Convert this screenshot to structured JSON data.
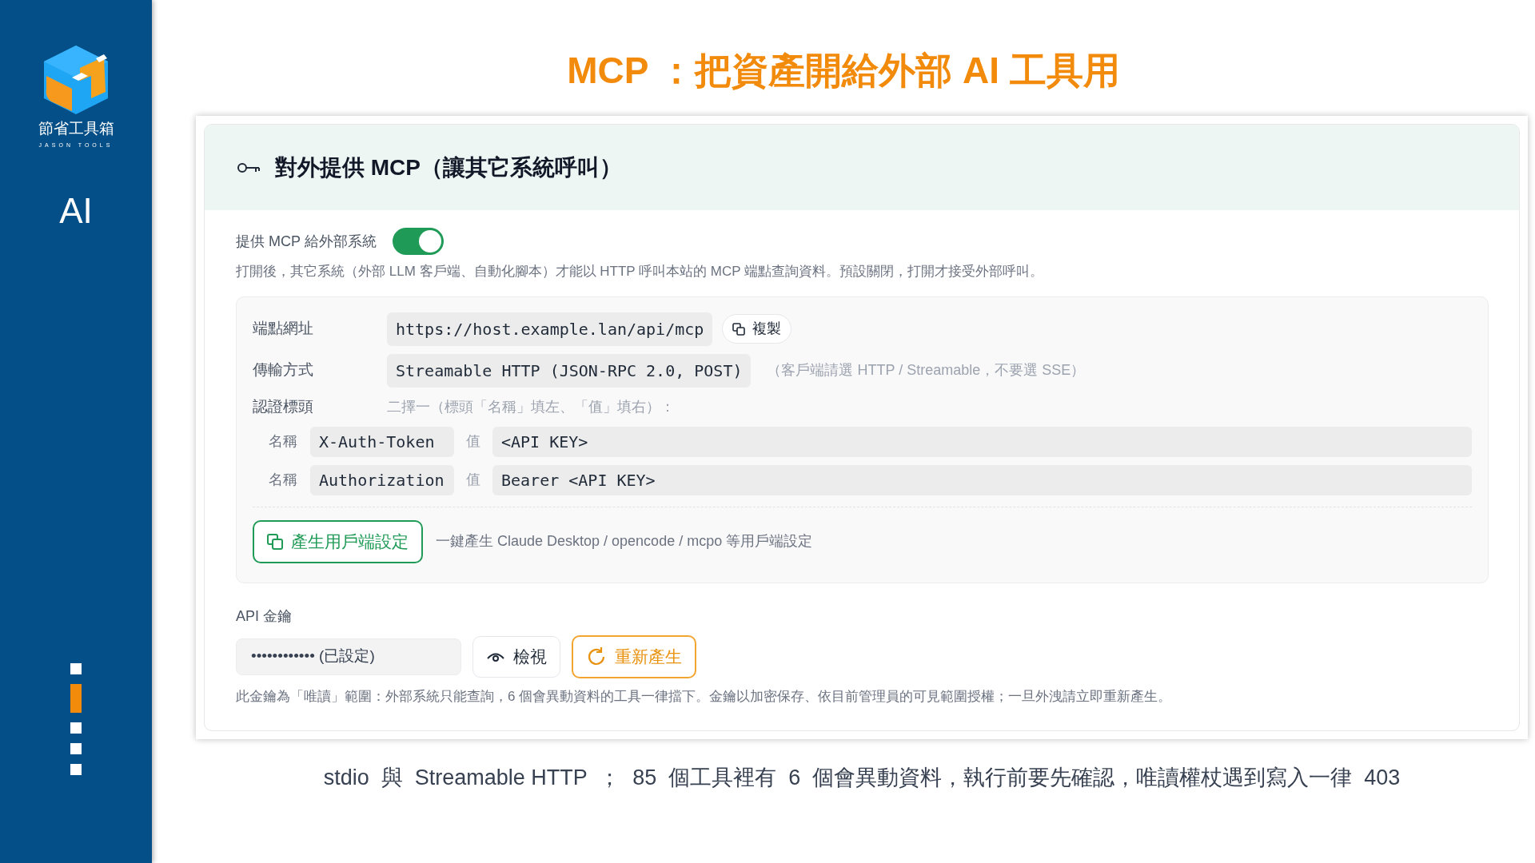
{
  "sidebar": {
    "brand": "節省工具箱",
    "brand_sub": "JASON TOOLS",
    "section": "AI",
    "nav_markers": [
      {
        "selected": false
      },
      {
        "selected": true
      },
      {
        "selected": false
      },
      {
        "selected": false
      },
      {
        "selected": false
      }
    ]
  },
  "slide_title": "MCP ：把資產開給外部  AI  工具用",
  "panel": {
    "title": "對外提供 MCP（讓其它系統呼叫）",
    "toggle": {
      "label": "提供 MCP 給外部系統",
      "on": true
    },
    "description": "打開後，其它系統（外部 LLM 客戶端、自動化腳本）才能以 HTTP 呼叫本站的 MCP 端點查詢資料。預設關閉，打開才接受外部呼叫。",
    "endpoint": {
      "label": "端點網址",
      "value": "https://host.example.lan/api/mcp",
      "copy": "複製"
    },
    "transport": {
      "label": "傳輸方式",
      "value": "Streamable HTTP (JSON-RPC 2.0, POST)",
      "hint": "（客戶端請選 HTTP / Streamable，不要選 SSE）"
    },
    "auth": {
      "label": "認證標頭",
      "hint": "二擇一（標頭「名稱」填左、「值」填右）：",
      "headers": [
        {
          "name_label": "名稱",
          "name": "X-Auth-Token",
          "value_label": "值",
          "value": "<API KEY>"
        },
        {
          "name_label": "名稱",
          "name": "Authorization",
          "value_label": "值",
          "value": "Bearer <API KEY>"
        }
      ]
    },
    "generate": {
      "button": "產生用戶端設定",
      "hint": "一鍵產生 Claude Desktop / opencode / mcpo 等用戶端設定"
    },
    "api_key": {
      "label": "API 金鑰",
      "value": "•••••••••••• (已設定)",
      "view": "檢視",
      "regenerate": "重新產生",
      "note": "此金鑰為「唯讀」範圍：外部系統只能查詢，6 個會異動資料的工具一律擋下。金鑰以加密保存、依目前管理員的可見範圍授權；一旦外洩請立即重新產生。"
    }
  },
  "caption": "stdio  與  Streamable HTTP  ；  85  個工具裡有  6  個會異動資料，執行前要先確認，唯讀權杖遇到寫入一律  403"
}
